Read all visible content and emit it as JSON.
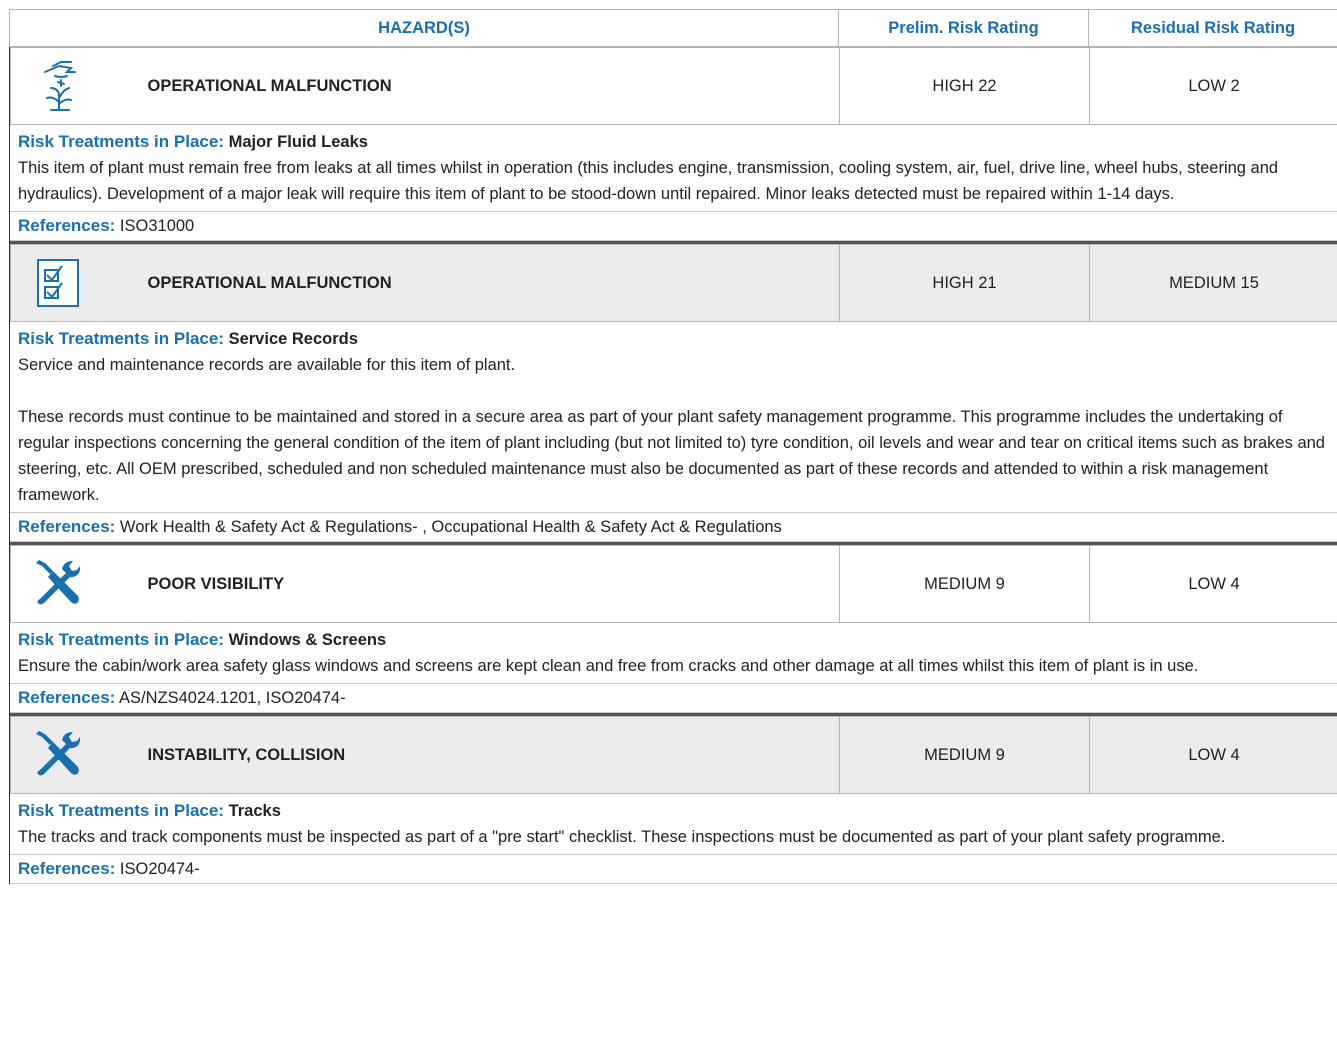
{
  "header": {
    "hazard": "HAZARD(S)",
    "prelim": "Prelim. Risk Rating",
    "residual": "Residual Risk Rating"
  },
  "labels": {
    "treatments": "Risk Treatments in Place:",
    "references": "References:"
  },
  "hazards": [
    {
      "icon": "leak-icon",
      "name": "OPERATIONAL MALFUNCTION",
      "prelim": "HIGH 22",
      "residual": "LOW 2",
      "treatment_title": "Major Fluid Leaks",
      "paragraphs": [
        "This item of plant must remain free from leaks at all times whilst in operation (this includes engine, transmission, cooling system, air, fuel, drive line, wheel hubs, steering and hydraulics). Development of a major leak will require this item of plant to be stood-down until repaired. Minor leaks detected must be repaired within 1-14 days."
      ],
      "references": "ISO31000"
    },
    {
      "icon": "checklist-icon",
      "name": "OPERATIONAL MALFUNCTION",
      "prelim": "HIGH 21",
      "residual": "MEDIUM 15",
      "treatment_title": "Service Records",
      "paragraphs": [
        "Service and maintenance records are available for this item of plant.",
        "",
        "These records must continue to be maintained and stored in a secure area as part of your plant safety management programme. This programme includes the undertaking of regular inspections concerning the general condition of the item of plant including (but not limited to) tyre condition, oil levels and wear and tear on critical items such as brakes and steering, etc. All OEM prescribed, scheduled and non scheduled maintenance must also be documented as part of these records and attended to within a risk management framework."
      ],
      "references": "Work Health & Safety Act & Regulations- , Occupational Health & Safety Act & Regulations"
    },
    {
      "icon": "tools-icon",
      "name": "POOR VISIBILITY",
      "prelim": "MEDIUM 9",
      "residual": "LOW 4",
      "treatment_title": "Windows & Screens",
      "paragraphs": [
        "Ensure the cabin/work area safety glass windows and screens are kept clean and free from cracks and other damage at all times whilst this item of plant is in use."
      ],
      "references": "AS/NZS4024.1201, ISO20474-"
    },
    {
      "icon": "tools-icon",
      "name": "INSTABILITY, COLLISION",
      "prelim": "MEDIUM 9",
      "residual": "LOW 4",
      "treatment_title": "Tracks",
      "paragraphs": [
        "The tracks and track components must be inspected as part of a \"pre start\" checklist. These inspections must be documented as part of your plant safety programme."
      ],
      "references": "ISO20474-"
    }
  ]
}
